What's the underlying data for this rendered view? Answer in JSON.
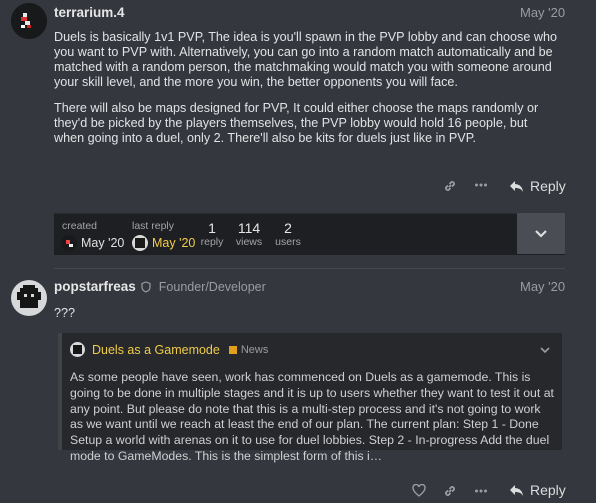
{
  "post1": {
    "username": "terrarium.4",
    "date": "May '20",
    "paragraphs": [
      "Duels is basically 1v1 PVP, The idea is you'll spawn in the PVP lobby and can choose who you want to PVP with. Alternatively, you can go into a random match automatically and be matched with a random person, the matchmaking would match you with someone around your skill level, and the more you win, the better opponents you will face.",
      "There will also be maps designed for PVP, It could either choose the maps randomly or they'd be picked by the players themselves, the PVP lobby would hold 16 people, but when going into a duel, only 2. There'll also be kits for duels just like in PVP."
    ],
    "reply_label": "Reply",
    "icons": [
      "link-icon",
      "more-icon",
      "reply-icon"
    ]
  },
  "topic_map": {
    "created_label": "created",
    "created_date": "May '20",
    "last_reply_label": "last reply",
    "last_reply_date": "May '20",
    "replies_count": "1",
    "replies_label": "reply",
    "views_count": "114",
    "views_label": "views",
    "users_count": "2",
    "users_label": "users"
  },
  "post2": {
    "username": "popstarfreas",
    "title": "Founder/Developer",
    "date": "May '20",
    "text": "???",
    "reply_label": "Reply",
    "icons": [
      "heart-icon",
      "link-icon",
      "more-icon",
      "reply-icon"
    ]
  },
  "quote": {
    "title": "Duels as a Gamemode",
    "category": "News",
    "category_color": "#e09f1c",
    "link_color": "#f0cc4a",
    "text": "As some people have seen, work has commenced on Duels as a gamemode. This is going to be done in multiple stages and it is up to users whether they want to test it out at any point. But please do note that this is a multi-step process and it's not going to work as we want until we reach at least the end of our plan. The current plan: Step 1 - Done Setup a world with arenas on it to use for duel lobbies. Step 2 - In-progress Add the duel mode to GameModes. This is the simplest form of this i…"
  }
}
